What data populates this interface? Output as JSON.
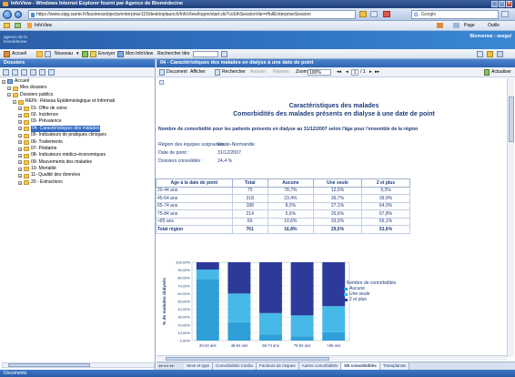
{
  "window": {
    "title": "InfoView - Windows Internet Explorer fourni par Agence de Biomédecine"
  },
  "browser": {
    "url": "https://www.sipg.sante.fr/businessobjects/enterprise115/desktoplaunch/InfoView/logon/start.do?ccEthSessionVar=#fullEnterpriseSession",
    "search_placeholder": "Google",
    "favorite": "InfoView",
    "page_menu": "Page",
    "tools_menu": "Outils"
  },
  "app": {
    "logo_line1": "agence de la",
    "logo_line2": "biomédecine",
    "welcome": "Bienvenue : asegui",
    "toolbar": {
      "home_label": "Accueil",
      "new_label": "Nouveau",
      "send_label": "Envoyer",
      "view_label": "Mon InfoView",
      "search_label": "Rechercher titre"
    }
  },
  "left_panel": {
    "title": "Dossiers",
    "tree": [
      {
        "label": "Accueil",
        "level": 0,
        "toggle": "-",
        "folder": false
      },
      {
        "label": "Mes dossiers",
        "level": 1,
        "toggle": "+",
        "folder": true
      },
      {
        "label": "Dossiers publics",
        "level": 1,
        "toggle": "-",
        "folder": true
      },
      {
        "label": "REIN : Réseau Epidémiologique et Informati",
        "level": 2,
        "toggle": "-",
        "folder": true
      },
      {
        "label": "01- Offre de soins",
        "level": 3,
        "toggle": "+",
        "folder": true
      },
      {
        "label": "02- Incidence",
        "level": 3,
        "toggle": "+",
        "folder": true
      },
      {
        "label": "03- Prévalence",
        "level": 3,
        "toggle": "+",
        "folder": true
      },
      {
        "label": "04- Caractéristiques des malades",
        "level": 3,
        "toggle": "+",
        "folder": true,
        "selected": true
      },
      {
        "label": "05- Indicateurs de pratiques cliniques",
        "level": 3,
        "toggle": "+",
        "folder": true
      },
      {
        "label": "06- Traitements",
        "level": 3,
        "toggle": "+",
        "folder": true
      },
      {
        "label": "07- Pédiatrie",
        "level": 3,
        "toggle": "+",
        "folder": true
      },
      {
        "label": "08- Indicateurs médico-économiques",
        "level": 3,
        "toggle": "+",
        "folder": true
      },
      {
        "label": "09- Mouvements des malades",
        "level": 3,
        "toggle": "+",
        "folder": true
      },
      {
        "label": "10- Mortalité",
        "level": 3,
        "toggle": "+",
        "folder": true
      },
      {
        "label": "11- Qualité des données",
        "level": 3,
        "toggle": "+",
        "folder": true
      },
      {
        "label": "20 - Extractions",
        "level": 3,
        "toggle": "+",
        "folder": true
      }
    ]
  },
  "right_panel": {
    "title": "04 - Caractéristiques des malades en dialyse à une date de point",
    "toolbar": {
      "document": "Document",
      "display": "Afficher",
      "search": "Rechercher",
      "cancel": "Annuler",
      "redo": "Répéter",
      "zoom_label": "Zoom",
      "zoom_value": "100%",
      "page": "1",
      "page_total": "/ 1",
      "refresh": "Actualiser"
    },
    "report": {
      "title1": "Caractéristiques des malades",
      "title2": "Comorbidités des malades présents en dialyse à une date de point",
      "subtitle": "Nombre de comorbidité pour les patients présents en dialyse au 31/12/2007 selon l'âge pour l'ensemble de la région",
      "info": [
        {
          "label": "Région des équipes soignantes :",
          "value": "Haute-Normandie"
        },
        {
          "label": "Date de point :",
          "value": "31/12/2007"
        },
        {
          "label": "Dossiers consolidés :",
          "value": "24,4 %"
        }
      ],
      "table": {
        "headers": [
          "Age à la date de point",
          "Total",
          "Aucune",
          "Une seule",
          "2 et plus"
        ],
        "rows": [
          [
            "20-44 ans",
            "75",
            "78,7%",
            "12,0%",
            "9,3%"
          ],
          [
            "45-64 ans",
            "218",
            "23,4%",
            "36,7%",
            "39,9%"
          ],
          [
            "65-74 ans",
            "188",
            "8,0%",
            "27,1%",
            "64,9%"
          ],
          [
            "75-84 ans",
            "214",
            "5,6%",
            "26,6%",
            "67,8%"
          ],
          [
            ">85 ans",
            "66",
            "10,6%",
            "33,3%",
            "56,1%"
          ]
        ],
        "total": [
          "Total région",
          "761",
          "16,8%",
          "29,5%",
          "53,6%"
        ]
      }
    }
  },
  "chart_data": {
    "type": "bar",
    "stacked": true,
    "categories": [
      "20-44 ans",
      "45-64 ans",
      "65-74 ans",
      "75-84 ans",
      ">85 ans"
    ],
    "ylabel": "% de malades dialysés",
    "ylim": [
      0,
      100
    ],
    "yticks": [
      "0,00%",
      "10,00%",
      "20,00%",
      "30,00%",
      "40,00%",
      "50,00%",
      "60,00%",
      "70,00%",
      "80,00%",
      "90,00%",
      "100,00%"
    ],
    "legend_title": "Nombre de comorbidités",
    "legend_position": "right",
    "series": [
      {
        "name": "Aucune",
        "values": [
          78.7,
          23.4,
          8.0,
          5.6,
          10.6
        ],
        "color": "#2f9fd8"
      },
      {
        "name": "Une seule",
        "values": [
          12.0,
          36.7,
          27.1,
          26.6,
          33.3
        ],
        "color": "#47b9e8"
      },
      {
        "name": "2 et plus",
        "values": [
          9.3,
          39.9,
          64.9,
          67.8,
          56.1
        ],
        "color": "#2d3a9a"
      }
    ]
  },
  "bottom_tabs": {
    "items": [
      "Sexe et type",
      "Comorbidités Cardio",
      "Facteurs de risques",
      "Autres comorbidités",
      "Nb comorbidités",
      "Transplantat"
    ],
    "active_index": 4
  },
  "status": {
    "text": "Documents"
  }
}
